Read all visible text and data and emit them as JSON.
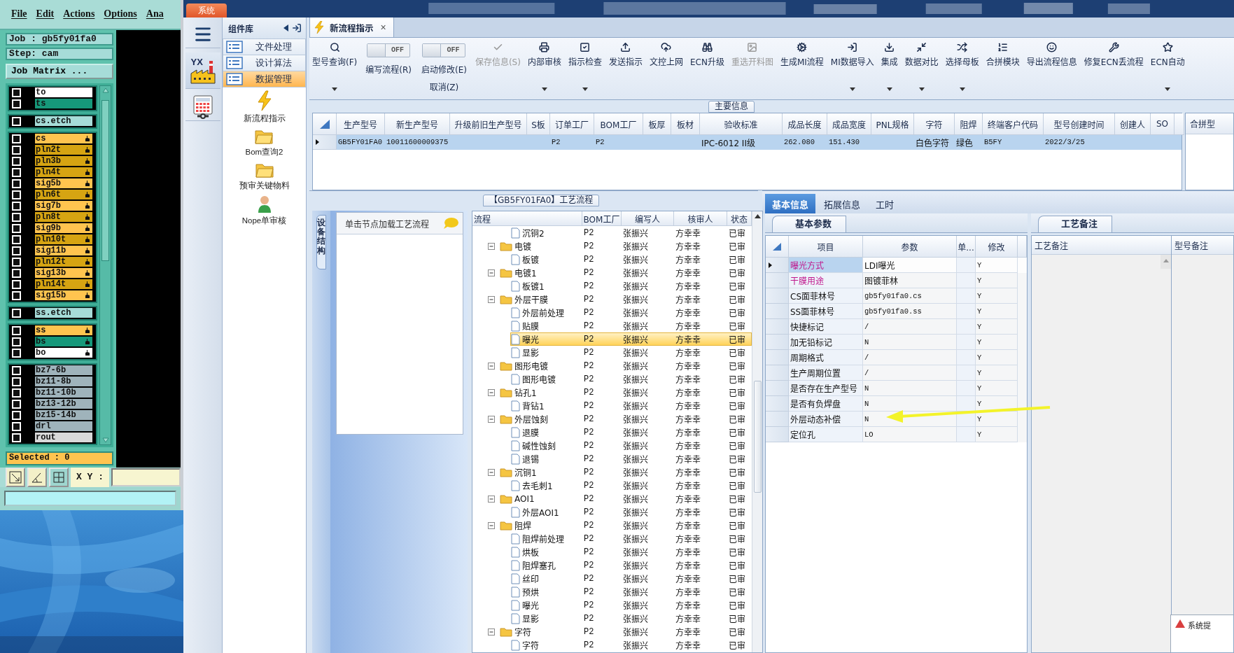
{
  "cam": {
    "menu": [
      "File",
      "Edit",
      "Actions",
      "Options",
      "Ana"
    ],
    "job": "Job : gb5fy01fa0",
    "step": "Step: cam",
    "matrix_button": "Job Matrix ...",
    "layer_groups": [
      [
        {
          "name": "to",
          "color": "#ffffff",
          "marked": false,
          "checked": false
        },
        {
          "name": "ts",
          "color": "#16987a",
          "marked": false,
          "checked": false
        }
      ],
      [
        {
          "name": "cs.etch",
          "color": "#a6dcd8",
          "marked": false,
          "checked": false
        }
      ],
      [
        {
          "name": "cs",
          "color": "#ffc44f",
          "marked": true,
          "checked": false
        },
        {
          "name": "pln2t",
          "color": "#d6a412",
          "marked": true,
          "checked": false
        },
        {
          "name": "pln3b",
          "color": "#d6a412",
          "marked": true,
          "checked": false
        },
        {
          "name": "pln4t",
          "color": "#d6a412",
          "marked": true,
          "checked": false
        },
        {
          "name": "sig5b",
          "color": "#ffc44f",
          "marked": true,
          "checked": false
        },
        {
          "name": "pln6t",
          "color": "#d6a412",
          "marked": true,
          "checked": false
        },
        {
          "name": "sig7b",
          "color": "#ffc44f",
          "marked": true,
          "checked": false
        },
        {
          "name": "pln8t",
          "color": "#d6a412",
          "marked": true,
          "checked": false
        },
        {
          "name": "sig9b",
          "color": "#ffc44f",
          "marked": true,
          "checked": false
        },
        {
          "name": "pln10t",
          "color": "#d6a412",
          "marked": true,
          "checked": false
        },
        {
          "name": "sig11b",
          "color": "#ffc44f",
          "marked": true,
          "checked": false
        },
        {
          "name": "pln12t",
          "color": "#d6a412",
          "marked": true,
          "checked": false
        },
        {
          "name": "sig13b",
          "color": "#ffc44f",
          "marked": true,
          "checked": false
        },
        {
          "name": "pln14t",
          "color": "#d6a412",
          "marked": true,
          "checked": false
        },
        {
          "name": "sig15b",
          "color": "#ffc44f",
          "marked": true,
          "checked": false
        }
      ],
      [
        {
          "name": "ss.etch",
          "color": "#a6dcd8",
          "marked": false,
          "checked": false
        }
      ],
      [
        {
          "name": "ss",
          "color": "#ffc44f",
          "marked": true,
          "checked": false
        },
        {
          "name": "bs",
          "color": "#16987a",
          "marked": true,
          "checked": false
        },
        {
          "name": "bo",
          "color": "#ffffff",
          "marked": true,
          "checked": false
        }
      ],
      [
        {
          "name": "bz7-6b",
          "color": "#9fb3bb",
          "marked": false,
          "checked": false
        },
        {
          "name": "bz11-8b",
          "color": "#9fb3bb",
          "marked": false,
          "checked": false
        },
        {
          "name": "bz11-10b",
          "color": "#9fb3bb",
          "marked": false,
          "checked": false
        },
        {
          "name": "bz13-12b",
          "color": "#9fb3bb",
          "marked": false,
          "checked": false
        },
        {
          "name": "bz15-14b",
          "color": "#9fb3bb",
          "marked": false,
          "checked": false
        },
        {
          "name": "drl",
          "color": "#9fb3bb",
          "marked": false,
          "checked": false
        },
        {
          "name": "rout",
          "color": "#d9d9d9",
          "marked": false,
          "checked": false
        }
      ]
    ],
    "selected": "Selected : 0",
    "xy_label": "X Y :"
  },
  "system_tab": "系统",
  "logo_text": "YX",
  "library": {
    "title": "组件库",
    "categories": [
      {
        "label": "文件处理",
        "selected": false
      },
      {
        "label": "设计算法",
        "selected": false
      },
      {
        "label": "数据管理",
        "selected": true
      }
    ],
    "tools": [
      "新流程指示",
      "Bom查询2",
      "预审关键物料",
      "Nope单审核"
    ]
  },
  "document_tab": {
    "title": "新流程指示",
    "close": "×"
  },
  "toolbar": [
    {
      "kind": "button",
      "label": "型号查询(F)",
      "disabled": false,
      "dropdown": true
    },
    {
      "kind": "toggle",
      "label": "编写流程(R)",
      "switch_text": "OFF",
      "on": false
    },
    {
      "kind": "toggle",
      "label": "启动修改(E)",
      "second_line": "取消(Z)",
      "switch_text": "OFF",
      "on": false
    },
    {
      "kind": "button",
      "label": "保存信息(S)",
      "disabled": true,
      "dropdown": false
    },
    {
      "kind": "button",
      "label": "内部审核",
      "disabled": false,
      "dropdown": true
    },
    {
      "kind": "button",
      "label": "指示检查",
      "disabled": false,
      "dropdown": true
    },
    {
      "kind": "button",
      "label": "发送指示",
      "disabled": false,
      "dropdown": false
    },
    {
      "kind": "button",
      "label": "文控上网",
      "disabled": false,
      "dropdown": false
    },
    {
      "kind": "button",
      "label": "ECN升级",
      "disabled": false,
      "dropdown": false
    },
    {
      "kind": "button",
      "label": "重选开料图",
      "disabled": true,
      "dropdown": false
    },
    {
      "kind": "button",
      "label": "生成MI流程",
      "disabled": false,
      "dropdown": false
    },
    {
      "kind": "button",
      "label": "MI数据导入",
      "disabled": false,
      "dropdown": true
    },
    {
      "kind": "button",
      "label": "集成",
      "disabled": false,
      "dropdown": true
    },
    {
      "kind": "button",
      "label": "数据对比",
      "disabled": false,
      "dropdown": true
    },
    {
      "kind": "button",
      "label": "选择母板",
      "disabled": false,
      "dropdown": true
    },
    {
      "kind": "button",
      "label": "合拼模块",
      "disabled": false,
      "dropdown": false
    },
    {
      "kind": "button",
      "label": "导出流程信息",
      "disabled": false,
      "dropdown": false
    },
    {
      "kind": "button",
      "label": "修复ECN丢流程",
      "disabled": false,
      "dropdown": false
    },
    {
      "kind": "button",
      "label": "ECN自动",
      "disabled": false,
      "dropdown": true
    }
  ],
  "main_info": {
    "title": "主要信息",
    "columns": [
      "生产型号",
      "新生产型号",
      "升级前旧生产型号",
      "S板",
      "订单工厂",
      "BOM工厂",
      "板厚",
      "板材",
      "验收标准",
      "成品长度",
      "成品宽度",
      "PNL规格",
      "字符",
      "阻焊",
      "终端客户代码",
      "型号创建时间",
      "创建人",
      "SO"
    ],
    "rows": [
      {
        "selected": true,
        "cells": [
          "GB5FY01FA0",
          "10011600009375",
          null,
          null,
          "P2",
          "P2",
          null,
          null,
          "IPC-6012 II级",
          "262.080",
          "151.430",
          null,
          "白色字符",
          "绿色",
          "B5FY",
          "2022/3/25",
          null,
          null
        ]
      }
    ],
    "side_column": "合拼型"
  },
  "process": {
    "title": "【GB5FY01FA0】工艺流程",
    "side_tab": "设备结构",
    "list_header": "单击节点加载工艺流程",
    "columns": [
      "流程",
      "BOM工厂",
      "编写人",
      "核审人",
      "状态"
    ],
    "rows": [
      {
        "kind": "continued",
        "children": [
          {
            "label": "沉铜2",
            "bom": "P2",
            "author": "张振兴",
            "reviewer": "方幸幸",
            "status": "已审",
            "selected": false
          }
        ]
      },
      {
        "label": "电镀",
        "bom": "P2",
        "author": "张振兴",
        "reviewer": "方幸幸",
        "status": "已审",
        "selected": false,
        "expanded": true,
        "children": [
          {
            "label": "板镀",
            "bom": "P2",
            "author": "张振兴",
            "reviewer": "方幸幸",
            "status": "已审",
            "selected": false
          }
        ]
      },
      {
        "label": "电镀1",
        "bom": "P2",
        "author": "张振兴",
        "reviewer": "方幸幸",
        "status": "已审",
        "selected": false,
        "expanded": true,
        "children": [
          {
            "label": "板镀1",
            "bom": "P2",
            "author": "张振兴",
            "reviewer": "方幸幸",
            "status": "已审",
            "selected": false
          }
        ]
      },
      {
        "label": "外层干膜",
        "bom": "P2",
        "author": "张振兴",
        "reviewer": "方幸幸",
        "status": "已审",
        "selected": false,
        "expanded": true,
        "children": [
          {
            "label": "外层前处理",
            "bom": "P2",
            "author": "张振兴",
            "reviewer": "方幸幸",
            "status": "已审",
            "selected": false
          },
          {
            "label": "贴膜",
            "bom": "P2",
            "author": "张振兴",
            "reviewer": "方幸幸",
            "status": "已审",
            "selected": false
          },
          {
            "label": "曝光",
            "bom": "P2",
            "author": "张振兴",
            "reviewer": "方幸幸",
            "status": "已审",
            "selected": true
          },
          {
            "label": "显影",
            "bom": "P2",
            "author": "张振兴",
            "reviewer": "方幸幸",
            "status": "已审",
            "selected": false
          }
        ]
      },
      {
        "label": "图形电镀",
        "bom": "P2",
        "author": "张振兴",
        "reviewer": "方幸幸",
        "status": "已审",
        "selected": false,
        "expanded": true,
        "children": [
          {
            "label": "图形电镀",
            "bom": "P2",
            "author": "张振兴",
            "reviewer": "方幸幸",
            "status": "已审",
            "selected": false
          }
        ]
      },
      {
        "label": "钻孔1",
        "bom": "P2",
        "author": "张振兴",
        "reviewer": "方幸幸",
        "status": "已审",
        "selected": false,
        "expanded": true,
        "children": [
          {
            "label": "背钻1",
            "bom": "P2",
            "author": "张振兴",
            "reviewer": "方幸幸",
            "status": "已审",
            "selected": false
          }
        ]
      },
      {
        "label": "外层蚀刻",
        "bom": "P2",
        "author": "张振兴",
        "reviewer": "方幸幸",
        "status": "已审",
        "selected": false,
        "expanded": true,
        "children": [
          {
            "label": "退膜",
            "bom": "P2",
            "author": "张振兴",
            "reviewer": "方幸幸",
            "status": "已审",
            "selected": false
          },
          {
            "label": "碱性蚀刻",
            "bom": "P2",
            "author": "张振兴",
            "reviewer": "方幸幸",
            "status": "已审",
            "selected": false
          },
          {
            "label": "退锡",
            "bom": "P2",
            "author": "张振兴",
            "reviewer": "方幸幸",
            "status": "已审",
            "selected": false
          }
        ]
      },
      {
        "label": "沉铜1",
        "bom": "P2",
        "author": "张振兴",
        "reviewer": "方幸幸",
        "status": "已审",
        "selected": false,
        "expanded": true,
        "children": [
          {
            "label": "去毛刺1",
            "bom": "P2",
            "author": "张振兴",
            "reviewer": "方幸幸",
            "status": "已审",
            "selected": false
          }
        ]
      },
      {
        "label": "AOI1",
        "bom": "P2",
        "author": "张振兴",
        "reviewer": "方幸幸",
        "status": "已审",
        "selected": false,
        "expanded": true,
        "children": [
          {
            "label": "外层AOI1",
            "bom": "P2",
            "author": "张振兴",
            "reviewer": "方幸幸",
            "status": "已审",
            "selected": false
          }
        ]
      },
      {
        "label": "阻焊",
        "bom": "P2",
        "author": "张振兴",
        "reviewer": "方幸幸",
        "status": "已审",
        "selected": false,
        "expanded": true,
        "children": [
          {
            "label": "阻焊前处理",
            "bom": "P2",
            "author": "张振兴",
            "reviewer": "方幸幸",
            "status": "已审",
            "selected": false
          },
          {
            "label": "烘板",
            "bom": "P2",
            "author": "张振兴",
            "reviewer": "方幸幸",
            "status": "已审",
            "selected": false
          },
          {
            "label": "阻焊塞孔",
            "bom": "P2",
            "author": "张振兴",
            "reviewer": "方幸幸",
            "status": "已审",
            "selected": false
          },
          {
            "label": "丝印",
            "bom": "P2",
            "author": "张振兴",
            "reviewer": "方幸幸",
            "status": "已审",
            "selected": false
          },
          {
            "label": "预烘",
            "bom": "P2",
            "author": "张振兴",
            "reviewer": "方幸幸",
            "status": "已审",
            "selected": false
          },
          {
            "label": "曝光",
            "bom": "P2",
            "author": "张振兴",
            "reviewer": "方幸幸",
            "status": "已审",
            "selected": false
          },
          {
            "label": "显影",
            "bom": "P2",
            "author": "张振兴",
            "reviewer": "方幸幸",
            "status": "已审",
            "selected": false
          }
        ]
      },
      {
        "label": "字符",
        "bom": "P2",
        "author": "张振兴",
        "reviewer": "方幸幸",
        "status": "已审",
        "selected": false,
        "expanded": true,
        "children": [
          {
            "label": "字符",
            "bom": "P2",
            "author": "张振兴",
            "reviewer": "方幸幸",
            "status": "已审",
            "selected": false
          }
        ]
      }
    ]
  },
  "detail_tabs": [
    {
      "label": "基本信息",
      "selected": true
    },
    {
      "label": "拓展信息",
      "selected": false
    },
    {
      "label": "工时",
      "selected": false
    }
  ],
  "params": {
    "title": "基本参数",
    "columns": [
      "项目",
      "参数",
      "单...",
      "修改"
    ],
    "rows": [
      {
        "name": "曝光方式",
        "value": "LDI曝光",
        "modify": "Y",
        "selected": true,
        "highlighted": true
      },
      {
        "name": "干膜用途",
        "value": "图镀菲林",
        "modify": "Y",
        "selected": false,
        "highlighted": true
      },
      {
        "name": "CS面菲林号",
        "value": "gb5fy01fa0.cs",
        "modify": "Y",
        "selected": false,
        "highlighted": false
      },
      {
        "name": "SS面菲林号",
        "value": "gb5fy01fa0.ss",
        "modify": "Y",
        "selected": false,
        "highlighted": false
      },
      {
        "name": "快捷标记",
        "value": "/",
        "modify": "Y",
        "selected": false,
        "highlighted": false
      },
      {
        "name": "加无铅标记",
        "value": "N",
        "modify": "Y",
        "selected": false,
        "highlighted": false
      },
      {
        "name": "周期格式",
        "value": "/",
        "modify": "Y",
        "selected": false,
        "highlighted": false
      },
      {
        "name": "生产周期位置",
        "value": "/",
        "modify": "Y",
        "selected": false,
        "highlighted": false
      },
      {
        "name": "是否存在生产型号",
        "value": "N",
        "modify": "Y",
        "selected": false,
        "highlighted": false
      },
      {
        "name": "是否有负焊盘",
        "value": "N",
        "modify": "Y",
        "selected": false,
        "highlighted": false
      },
      {
        "name": "外层动态补偿",
        "value": "N",
        "modify": "Y",
        "selected": false,
        "highlighted": false
      },
      {
        "name": "定位孔",
        "value": "LO",
        "modify": "Y",
        "selected": false,
        "highlighted": false
      }
    ]
  },
  "notes": {
    "title": "工艺备注",
    "columns": [
      "工艺备注",
      "型号备注"
    ]
  },
  "popup": {
    "title": "系统提"
  }
}
